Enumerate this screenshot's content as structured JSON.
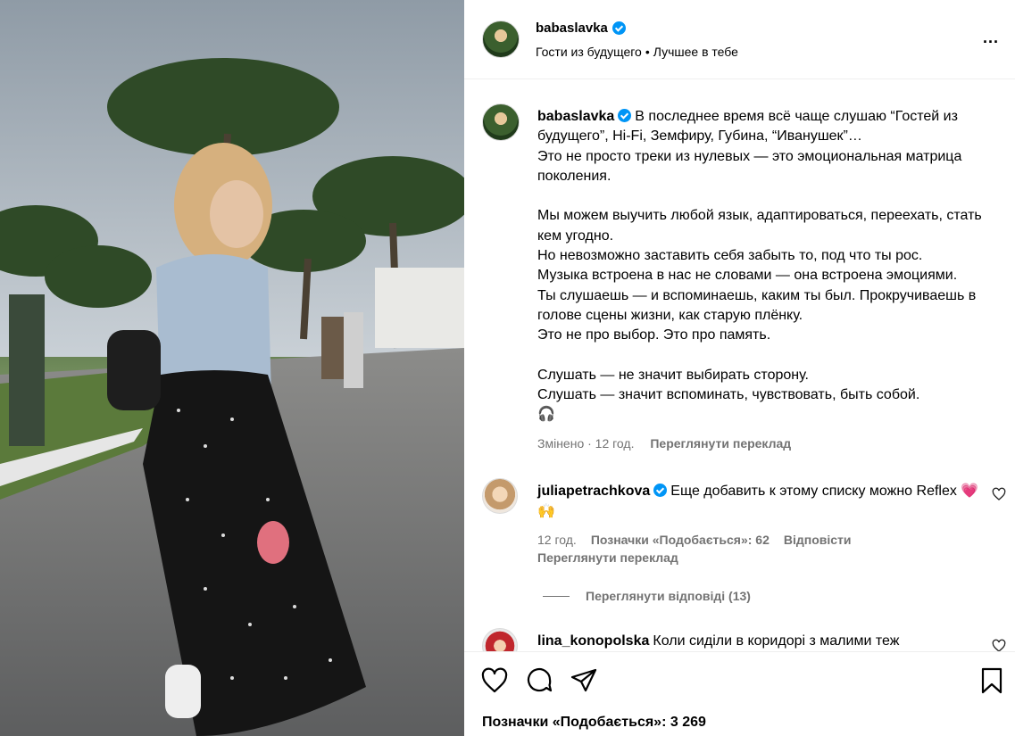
{
  "post": {
    "username": "babaslavka",
    "audio_title": "Гости из будущего",
    "separator": "•",
    "audio_subtitle": "Лучшее в тебе",
    "more_label": "..."
  },
  "caption": {
    "username": "babaslavka",
    "text": "В последнее время всё чаще слушаю “Гостей из будущего”, Hi-Fi, Земфиру, Губина, “Иванушек”…\nЭто не просто треки из нулевых — это эмоциональная матрица поколения.\n\nМы можем выучить любой язык, адаптироваться, переехать, стать кем угодно.\nНо невозможно заставить себя забыть то, под что ты рос.\nМузыка встроена в нас не словами — она встроена эмоциями.\nТы слушаешь — и вспоминаешь, каким ты был. Прокручиваешь в голове сцены жизни, как старую плёнку.\nЭто не про выбор. Это про память.\n\nСлушать — не значит выбирать сторону.\nСлушать — значит вспоминать, чувствовать, быть собой.\n🎧",
    "edited": "Змінено · 12 год.",
    "translate": "Переглянути переклад"
  },
  "comments": [
    {
      "username": "juliapetrachkova",
      "text": "Еще добавить к этому списку можно Reflex 💗 🙌",
      "time": "12 год.",
      "likes": "Позначки «Подобається»: 62",
      "reply": "Відповісти",
      "translate": "Переглянути переклад",
      "view_replies": "Переглянути відповіді (13)"
    },
    {
      "username": "lina_konopolska",
      "text": "Коли сиділи в коридорі з малими теж"
    }
  ],
  "footer": {
    "likes_text": "Позначки «Подобається»: 3 269"
  },
  "icons": [
    "heart-icon",
    "comment-icon",
    "share-icon",
    "bookmark-icon",
    "verified-badge-icon",
    "more-icon"
  ],
  "colors": {
    "verified": "#0095f6",
    "muted": "#737373"
  }
}
